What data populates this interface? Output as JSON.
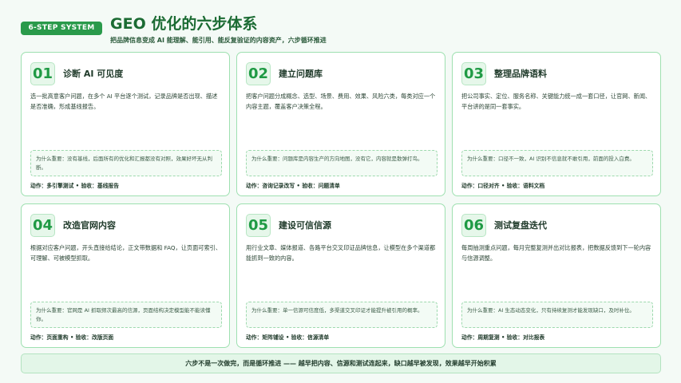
{
  "header": {
    "badge": "6-STEP SYSTEM",
    "title": "GEO 优化的六步体系",
    "subtitle": "把品牌信息变成 AI 能理解、能引用、能反复验证的内容资产，六步循环推进"
  },
  "cards": [
    {
      "num": "01",
      "title": "诊断 AI 可见度",
      "body": "选一批高意客户问题，在多个 AI 平台逐个测试，记录品牌是否出现、描述是否准确，形成基线报告。",
      "note_label": "为什么重要：",
      "note": "没有基线，后面所有的优化和汇报都没有对照，效果好坏无从判断。",
      "action": "动作：多引擎测试 • 验收：基线报告"
    },
    {
      "num": "02",
      "title": "建立问题库",
      "body": "把客户问题分成概念、选型、场景、费用、效果、风险六类，每类对应一个内容主题，覆盖客户决策全程。",
      "note_label": "为什么重要：",
      "note": "问题库是内容生产的方向地图，没有它，内容就是散弹打鸟。",
      "action": "动作：咨询记录改写 • 验收：问题清单"
    },
    {
      "num": "03",
      "title": "整理品牌语料",
      "body": "把公司事实、定位、服务名称、关键能力统一成一套口径，让官网、新闻、平台讲的是同一套事实。",
      "note_label": "为什么重要：",
      "note": "口径不一致，AI 识别不信息就不敢引用，前面的投入白费。",
      "action": "动作：口径对齐 • 验收：语料文档"
    },
    {
      "num": "04",
      "title": "改造官网内容",
      "body": "根据对应客户问题，开头直接给结论，正文带数据和 FAQ，让页面可索引、可理解、可被模型抓取。",
      "note_label": "为什么重要：",
      "note": "官网是 AI 抓取频次最高的信源，页面结构决定模型能不能读懂你。",
      "action": "动作：页面重构 • 验收：改版页面"
    },
    {
      "num": "05",
      "title": "建设可信信源",
      "body": "用行业文章、媒体报道、各路平台交叉印证品牌信息，让模型在多个渠道都能抓到一致的内容。",
      "note_label": "为什么重要：",
      "note": "单一信源可信度低，多渠道交叉印证才能提升被引用的概率。",
      "action": "动作：矩阵铺设 • 验收：信源清单"
    },
    {
      "num": "06",
      "title": "测试复盘迭代",
      "body": "每周抽测重点问题，每月完整复测并出对比报表，把数据反馈到下一轮内容与信源调整。",
      "note_label": "为什么重要：",
      "note": "AI 生态动态变化，只有持续复测才能发现缺口，及时补位。",
      "action": "动作：周期复测 • 验收：对比报表"
    }
  ],
  "footer": "六步不是一次做完，而是循环推进 —— 越早把内容、信源和测试连起来，缺口越早被发现，效果越早开始积累"
}
